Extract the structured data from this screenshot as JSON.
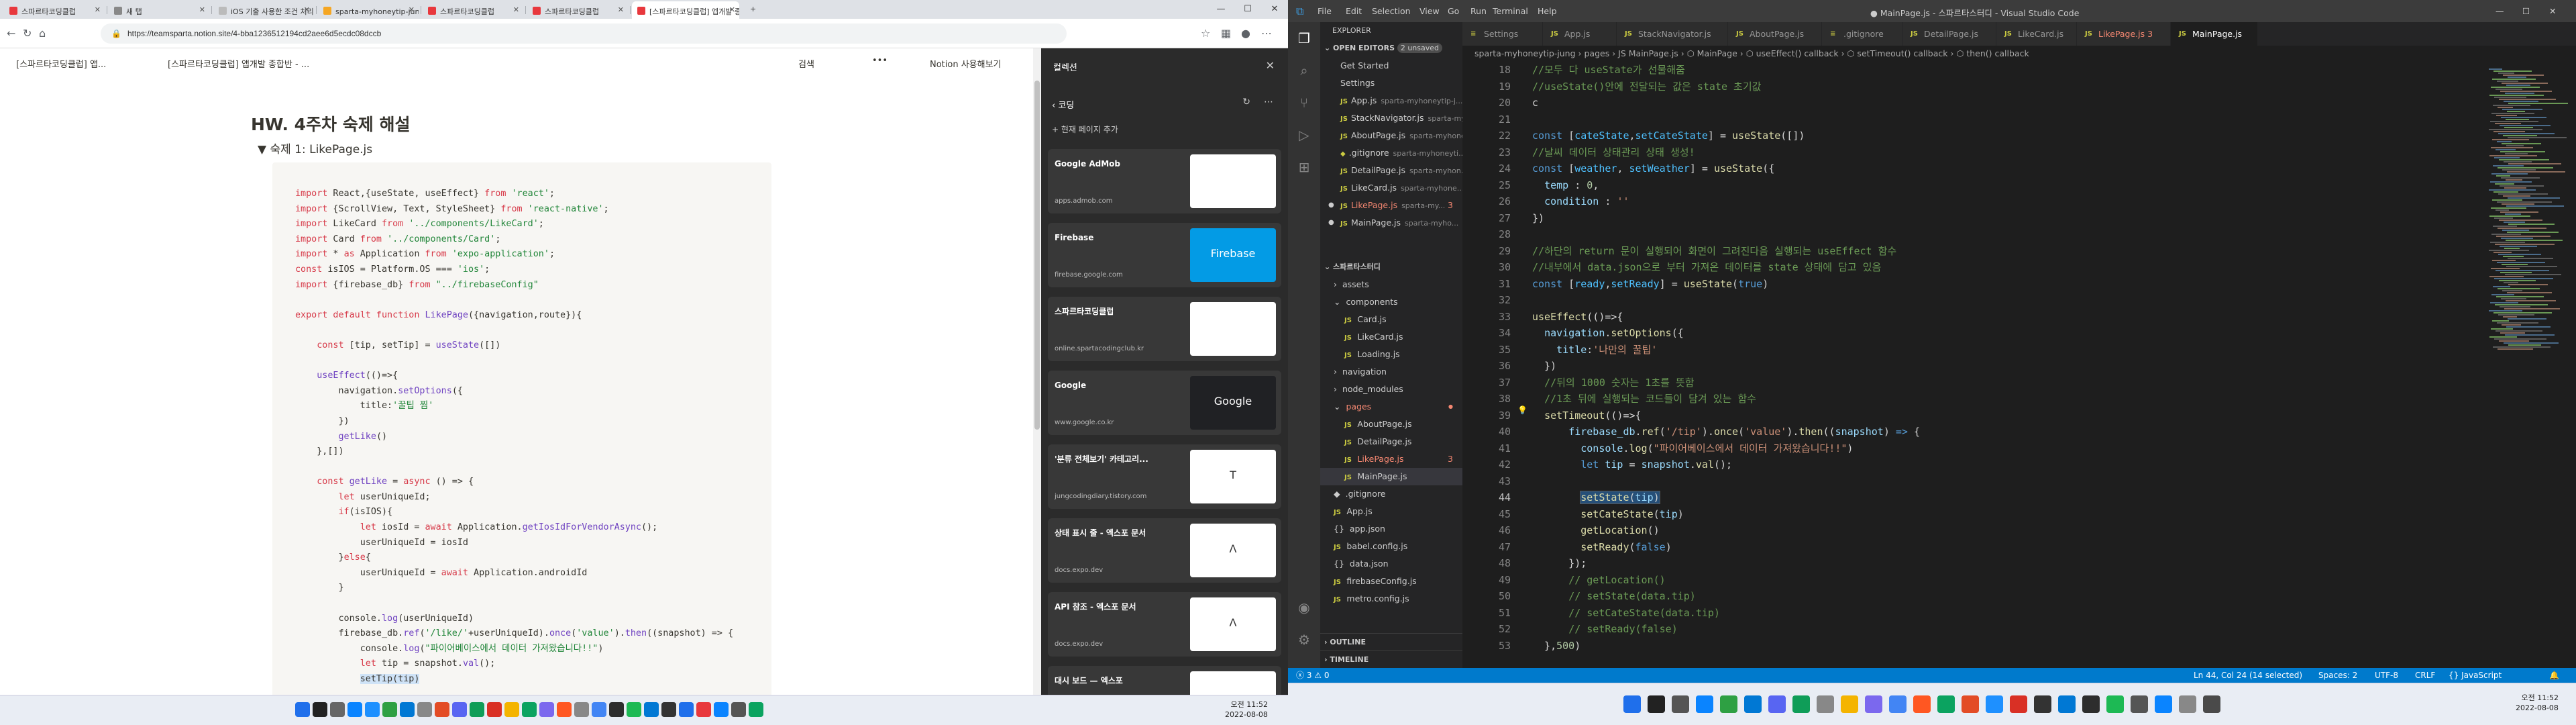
{
  "browser": {
    "tabs": [
      {
        "label": "스파르타코딩클럽",
        "color": "#e8383d"
      },
      {
        "label": "새 탭",
        "color": "#888888"
      },
      {
        "label": "iOS 기출 사용한 조건 처리",
        "color": "#bbbbbb"
      },
      {
        "label": "sparta-myhoneytip-jung - 실시간",
        "color": "#f5a623"
      },
      {
        "label": "스파르타코딩클럽",
        "color": "#e8383d"
      },
      {
        "label": "스파르타코딩클럽",
        "color": "#e8383d"
      },
      {
        "label": "[스파르타코딩클럽] 엡개발 종",
        "color": "#e8383d"
      }
    ],
    "new_tab": "+",
    "url": "https://teamsparta.notion.site/4-bba1236512194cd2aee6d5ecdc08dccb",
    "breadcrumb1": "[스파르타코딩클럽] 앱...",
    "breadcrumb2": "[스파르타코딩클럽] 앱개발 종합반 - ...",
    "search": "검색",
    "more": "•••",
    "notion_cta": "Notion 사용해보기",
    "heading": "HW. 4주차 숙제 해설",
    "toggle": "▼  숙제 1: LikePage.js"
  },
  "collections": {
    "title": "컬렉션",
    "nav": "‹  코딩",
    "add": "+ 현재 페이지 추가",
    "cards": [
      {
        "title": "Google AdMob",
        "url": "apps.admob.com",
        "thumb": "#ffffff",
        "thumb_text": ""
      },
      {
        "title": "Firebase",
        "url": "firebase.google.com",
        "thumb": "#039be5",
        "thumb_text": "Firebase"
      },
      {
        "title": "스파르타코딩클럽",
        "url": "online.spartacodingclub.kr",
        "thumb": "#ffffff",
        "thumb_text": ""
      },
      {
        "title": "Google",
        "url": "www.google.co.kr",
        "thumb": "#202124",
        "thumb_text": "Google"
      },
      {
        "title": "'분류 전체보기' 카테고리...",
        "url": "jungcodingdiary.tistory.com",
        "thumb": "#ffffff",
        "thumb_text": "T"
      },
      {
        "title": "상태 표시 줄 - 엑스포 문서",
        "url": "docs.expo.dev",
        "thumb": "#ffffff",
        "thumb_text": "Λ"
      },
      {
        "title": "API 참조 - 엑스포 문서",
        "url": "docs.expo.dev",
        "thumb": "#ffffff",
        "thumb_text": "Λ"
      },
      {
        "title": "대시 보드 — 엑스포",
        "url": "",
        "thumb": "#ffffff",
        "thumb_text": ""
      }
    ]
  },
  "taskbar_clock": {
    "time": "오전 11:52",
    "date": "2022-08-08"
  },
  "vscode": {
    "menu": [
      "File",
      "Edit",
      "Selection",
      "View",
      "Go",
      "Run",
      "Terminal",
      "Help"
    ],
    "title": "● MainPage.js - 스파르타스터디 - Visual Studio Code",
    "explorer": "EXPLORER",
    "open_editors": "OPEN EDITORS",
    "unsaved": "2 unsaved",
    "open_list": [
      {
        "name": "Get Started",
        "path": "",
        "icon": "",
        "mod": ""
      },
      {
        "name": "Settings",
        "path": "",
        "icon": "",
        "mod": ""
      },
      {
        "name": "App.js",
        "path": "sparta-myhoneytip-j...",
        "icon": "JS",
        "mod": ""
      },
      {
        "name": "StackNavigator.js",
        "path": "sparta-myh...",
        "icon": "JS",
        "mod": ""
      },
      {
        "name": "AboutPage.js",
        "path": "sparta-myhone...",
        "icon": "JS",
        "mod": ""
      },
      {
        "name": ".gitignore",
        "path": "sparta-myhoneyti...",
        "icon": "◆",
        "mod": ""
      },
      {
        "name": "DetailPage.js",
        "path": "sparta-myhon...",
        "icon": "JS",
        "mod": ""
      },
      {
        "name": "LikeCard.js",
        "path": "sparta-myhone...",
        "icon": "JS",
        "mod": ""
      },
      {
        "name": "LikePage.js",
        "path": "sparta-my...",
        "icon": "JS",
        "mod": "3"
      },
      {
        "name": "MainPage.js",
        "path": "sparta-myho...",
        "icon": "JS",
        "mod": ""
      }
    ],
    "root": "스파르타스터디",
    "tree": [
      {
        "name": "assets",
        "indent": 1,
        "icon": "›",
        "cls": ""
      },
      {
        "name": "components",
        "indent": 1,
        "icon": "⌄",
        "cls": ""
      },
      {
        "name": "Card.js",
        "indent": 2,
        "icon": "JS",
        "cls": ""
      },
      {
        "name": "LikeCard.js",
        "indent": 2,
        "icon": "JS",
        "cls": ""
      },
      {
        "name": "Loading.js",
        "indent": 2,
        "icon": "JS",
        "cls": ""
      },
      {
        "name": "navigation",
        "indent": 1,
        "icon": "›",
        "cls": ""
      },
      {
        "name": "node_modules",
        "indent": 1,
        "icon": "›",
        "cls": ""
      },
      {
        "name": "pages",
        "indent": 1,
        "icon": "⌄",
        "cls": "red"
      },
      {
        "name": "AboutPage.js",
        "indent": 2,
        "icon": "JS",
        "cls": ""
      },
      {
        "name": "DetailPage.js",
        "indent": 2,
        "icon": "JS",
        "cls": ""
      },
      {
        "name": "LikePage.js",
        "indent": 2,
        "icon": "JS",
        "cls": "red"
      },
      {
        "name": "MainPage.js",
        "indent": 2,
        "icon": "JS",
        "cls": ""
      },
      {
        "name": ".gitignore",
        "indent": 1,
        "icon": "◆",
        "cls": ""
      },
      {
        "name": "App.js",
        "indent": 1,
        "icon": "JS",
        "cls": ""
      },
      {
        "name": "app.json",
        "indent": 1,
        "icon": "{}",
        "cls": ""
      },
      {
        "name": "babel.config.js",
        "indent": 1,
        "icon": "JS",
        "cls": ""
      },
      {
        "name": "data.json",
        "indent": 1,
        "icon": "{}",
        "cls": ""
      },
      {
        "name": "firebaseConfig.js",
        "indent": 1,
        "icon": "JS",
        "cls": ""
      },
      {
        "name": "metro.config.js",
        "indent": 1,
        "icon": "JS",
        "cls": ""
      }
    ],
    "outline": "OUTLINE",
    "timeline": "TIMELINE",
    "tabs": [
      "Settings",
      "App.js",
      "StackNavigator.js",
      "AboutPage.js",
      ".gitignore",
      "DetailPage.js",
      "LikeCard.js",
      "LikePage.js 3",
      "MainPage.js"
    ],
    "breadcrumb": "sparta-myhoneytip-jung  ›  pages  ›  JS MainPage.js  ›  ⬡ MainPage  ›  ⬡ useEffect() callback  ›  ⬡ setTimeout() callback  ›  ⬡ then() callback",
    "status": {
      "errors": "ⓧ 3  ⚠ 0",
      "pos": "Ln 44, Col 24 (14 selected)",
      "spaces": "Spaces: 2",
      "enc": "UTF-8",
      "eol": "CRLF",
      "lang": "{} JavaScript"
    }
  }
}
